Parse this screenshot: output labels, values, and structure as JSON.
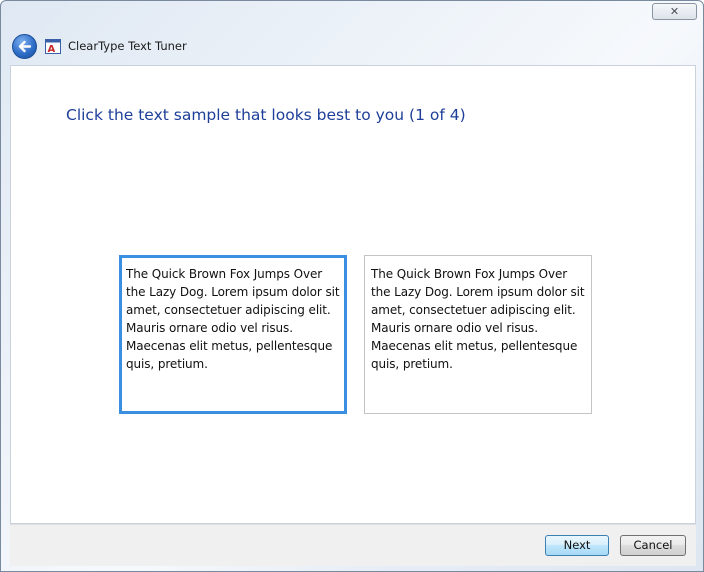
{
  "window": {
    "close_label": "✕",
    "title": "ClearType Text Tuner"
  },
  "page": {
    "instruction": "Click the text sample that looks best to you (1 of 4)"
  },
  "samples": [
    {
      "text": "The Quick Brown Fox Jumps Over the Lazy Dog. Lorem ipsum dolor sit amet, consectetuer adipiscing elit. Mauris ornare odio vel risus. Maecenas elit metus, pellentesque quis, pretium.",
      "selected": true
    },
    {
      "text": "The Quick Brown Fox Jumps Over the Lazy Dog. Lorem ipsum dolor sit amet, consectetuer adipiscing elit. Mauris ornare odio vel risus. Maecenas elit metus, pellentesque quis, pretium.",
      "selected": false
    }
  ],
  "footer": {
    "next_label": "Next",
    "cancel_label": "Cancel"
  },
  "colors": {
    "instruction": "#1e3f99",
    "selected_border": "#3b8fe0"
  },
  "icons": {
    "back": "back-arrow-icon",
    "app": "cleartype-app-icon",
    "close": "close-icon"
  }
}
